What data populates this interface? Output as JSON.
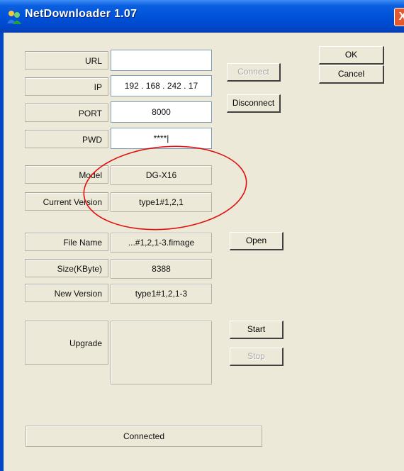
{
  "window": {
    "title": "NetDownloader 1.07",
    "close_glyph": "X"
  },
  "fields": {
    "url": {
      "label": "URL",
      "value": ""
    },
    "ip": {
      "label": "IP",
      "value": "192 . 168 . 242 . 17"
    },
    "port": {
      "label": "PORT",
      "value": "8000"
    },
    "pwd": {
      "label": "PWD",
      "value": "****|"
    }
  },
  "info": {
    "model": {
      "label": "Model",
      "value": "DG-X16"
    },
    "current_version": {
      "label": "Current Version",
      "value": "type1#1,2,1"
    },
    "file_name": {
      "label": "File Name",
      "value": "...#1,2,1-3.fimage"
    },
    "size": {
      "label": "Size(KByte)",
      "value": "8388"
    },
    "new_version": {
      "label": "New Version",
      "value": "type1#1,2,1-3"
    },
    "upgrade": {
      "label": "Upgrade",
      "value": ""
    }
  },
  "buttons": {
    "ok": "OK",
    "cancel": "Cancel",
    "connect": "Connect",
    "disconnect": "Disconnect",
    "open": "Open",
    "start": "Start",
    "stop": "Stop"
  },
  "status": "Connected",
  "annotation_color": "#e01010",
  "title_icon": "people-icon"
}
